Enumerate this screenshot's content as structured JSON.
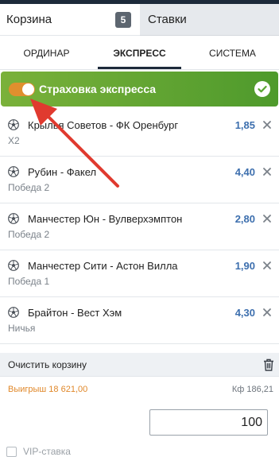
{
  "tabs": {
    "cart_label": "Корзина",
    "cart_count": "5",
    "bets_label": "Ставки"
  },
  "subtabs": [
    {
      "label": "ОРДИНАР",
      "active": false
    },
    {
      "label": "ЭКСПРЕСС",
      "active": true
    },
    {
      "label": "СИСТЕМА",
      "active": false
    }
  ],
  "insurance": {
    "label": "Страховка экспресса",
    "enabled": true
  },
  "bets": [
    {
      "match": "Крылья Советов - ФК Оренбург",
      "outcome": "Х2",
      "odd": "1,85"
    },
    {
      "match": "Рубин - Факел",
      "outcome": "Победа 2",
      "odd": "4,40"
    },
    {
      "match": "Манчестер Юн - Вулверхэмптон",
      "outcome": "Победа 2",
      "odd": "2,80"
    },
    {
      "match": "Манчестер Сити - Астон Вилла",
      "outcome": "Победа 1",
      "odd": "1,90"
    },
    {
      "match": "Брайтон - Вест Хэм",
      "outcome": "Ничья",
      "odd": "4,30"
    }
  ],
  "footer": {
    "clear_label": "Очистить корзину",
    "win_label": "Выигрыш 18 621,00",
    "coef_label": "Кф 186,21",
    "stake_value": "100",
    "vip_label": "VIP-ставка"
  },
  "colors": {
    "accent_green": "#5aa532",
    "toggle_orange": "#e08f2e",
    "odd_blue": "#3d6fae",
    "win_orange": "#e0882a",
    "annotation_red": "#e03a2f"
  },
  "icons": {
    "ball": "soccer-ball-icon",
    "close": "close-icon",
    "check": "check-circle-icon",
    "trash": "trash-icon"
  }
}
